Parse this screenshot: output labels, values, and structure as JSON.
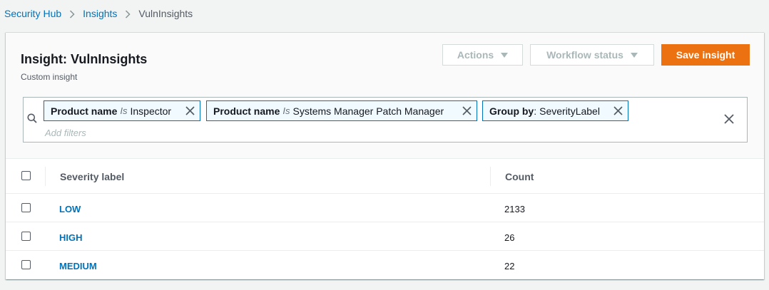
{
  "breadcrumb": {
    "items": [
      {
        "label": "Security Hub"
      },
      {
        "label": "Insights"
      },
      {
        "label": "VulnInsights"
      }
    ]
  },
  "header": {
    "title": "Insight: VulnInsights",
    "subtitle": "Custom insight",
    "actions_label": "Actions",
    "workflow_label": "Workflow status",
    "save_label": "Save insight"
  },
  "filters": {
    "tokens": [
      {
        "key": "Product name",
        "op": "Is",
        "value": "Inspector"
      },
      {
        "key": "Product name",
        "op": "Is",
        "value": "Systems Manager Patch Manager"
      },
      {
        "key": "Group by",
        "op": ":",
        "value": "SeverityLabel"
      }
    ],
    "placeholder": "Add filters"
  },
  "table": {
    "columns": [
      "Severity label",
      "Count"
    ],
    "rows": [
      {
        "severity": "LOW",
        "count": "2133"
      },
      {
        "severity": "HIGH",
        "count": "26"
      },
      {
        "severity": "MEDIUM",
        "count": "22"
      }
    ]
  },
  "colors": {
    "link": "#0073bb",
    "primary": "#ec7211",
    "disabled": "#aab7b8",
    "token_border": "#0073bb"
  }
}
